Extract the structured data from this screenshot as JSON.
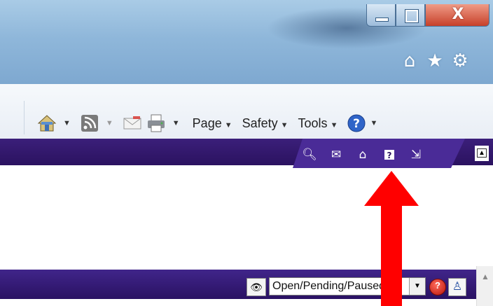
{
  "window": {
    "controls": {
      "minimize_icon": "minimize-icon",
      "maximize_icon": "maximize-icon",
      "close_glyph": "X"
    },
    "nav_icons": [
      "home-icon",
      "star-icon",
      "gear-icon"
    ]
  },
  "command_bar": {
    "icons": [
      "home-icon",
      "feeds-icon",
      "mail-icon",
      "print-icon"
    ],
    "menus": [
      {
        "label": "Page"
      },
      {
        "label": "Safety"
      },
      {
        "label": "Tools"
      }
    ],
    "help_icon": "help-icon"
  },
  "app_toolbar": {
    "icons": [
      "search-icon",
      "mail-icon",
      "home-icon",
      "help-icon",
      "exit-icon"
    ]
  },
  "bottom_toolbar": {
    "status_select": {
      "value": "Open/Pending/Paused"
    }
  },
  "colors": {
    "purple_dark": "#2b1260",
    "purple_tab": "#4a2b97",
    "annotation_arrow": "#ff0000"
  }
}
